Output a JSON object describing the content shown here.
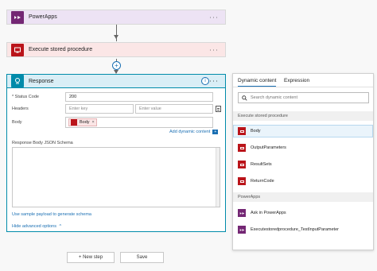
{
  "flow": {
    "powerapps_card": {
      "title": "PowerApps",
      "icon": "powerapps-icon",
      "color": "#742774",
      "bg": "#ede3f4"
    },
    "stored_proc_card": {
      "title": "Execute stored procedure",
      "icon": "sql-server-icon",
      "color": "#ba141a",
      "bg": "#fbe6e6"
    },
    "plus_symbol": "+"
  },
  "response": {
    "title": "Response",
    "icon": "response-icon",
    "header_color": "#008baa",
    "header_bg": "#d9eef6",
    "info_symbol": "i",
    "fields": {
      "status_code": {
        "label": "* Status Code",
        "value": "200"
      },
      "headers": {
        "label": "Headers",
        "key_placeholder": "Enter key",
        "value_placeholder": "Enter value"
      },
      "body": {
        "label": "Body",
        "token": "Body",
        "token_close": "×"
      },
      "schema": {
        "label": "Response Body JSON Schema"
      }
    },
    "add_dynamic_content": "Add dynamic content",
    "add_dynamic_badge": "+",
    "sample_payload_link": "Use sample payload to generate schema",
    "hide_advanced": "Hide advanced options",
    "hide_advanced_chevron": "^"
  },
  "buttons": {
    "new_step": "+ New step",
    "save": "Save"
  },
  "dynamic_panel": {
    "tabs": [
      "Dynamic content",
      "Expression"
    ],
    "search_placeholder": "Search dynamic content",
    "sections": [
      {
        "header": "Execute stored procedure",
        "color": "#ba141a",
        "items": [
          "Body",
          "OutputParameters",
          "ResultSets",
          "ReturnCode"
        ]
      },
      {
        "header": "PowerApps",
        "color": "#742774",
        "items": [
          "Ask in PowerApps",
          "Executestoredprocedure_TestInputParameter"
        ]
      }
    ]
  }
}
